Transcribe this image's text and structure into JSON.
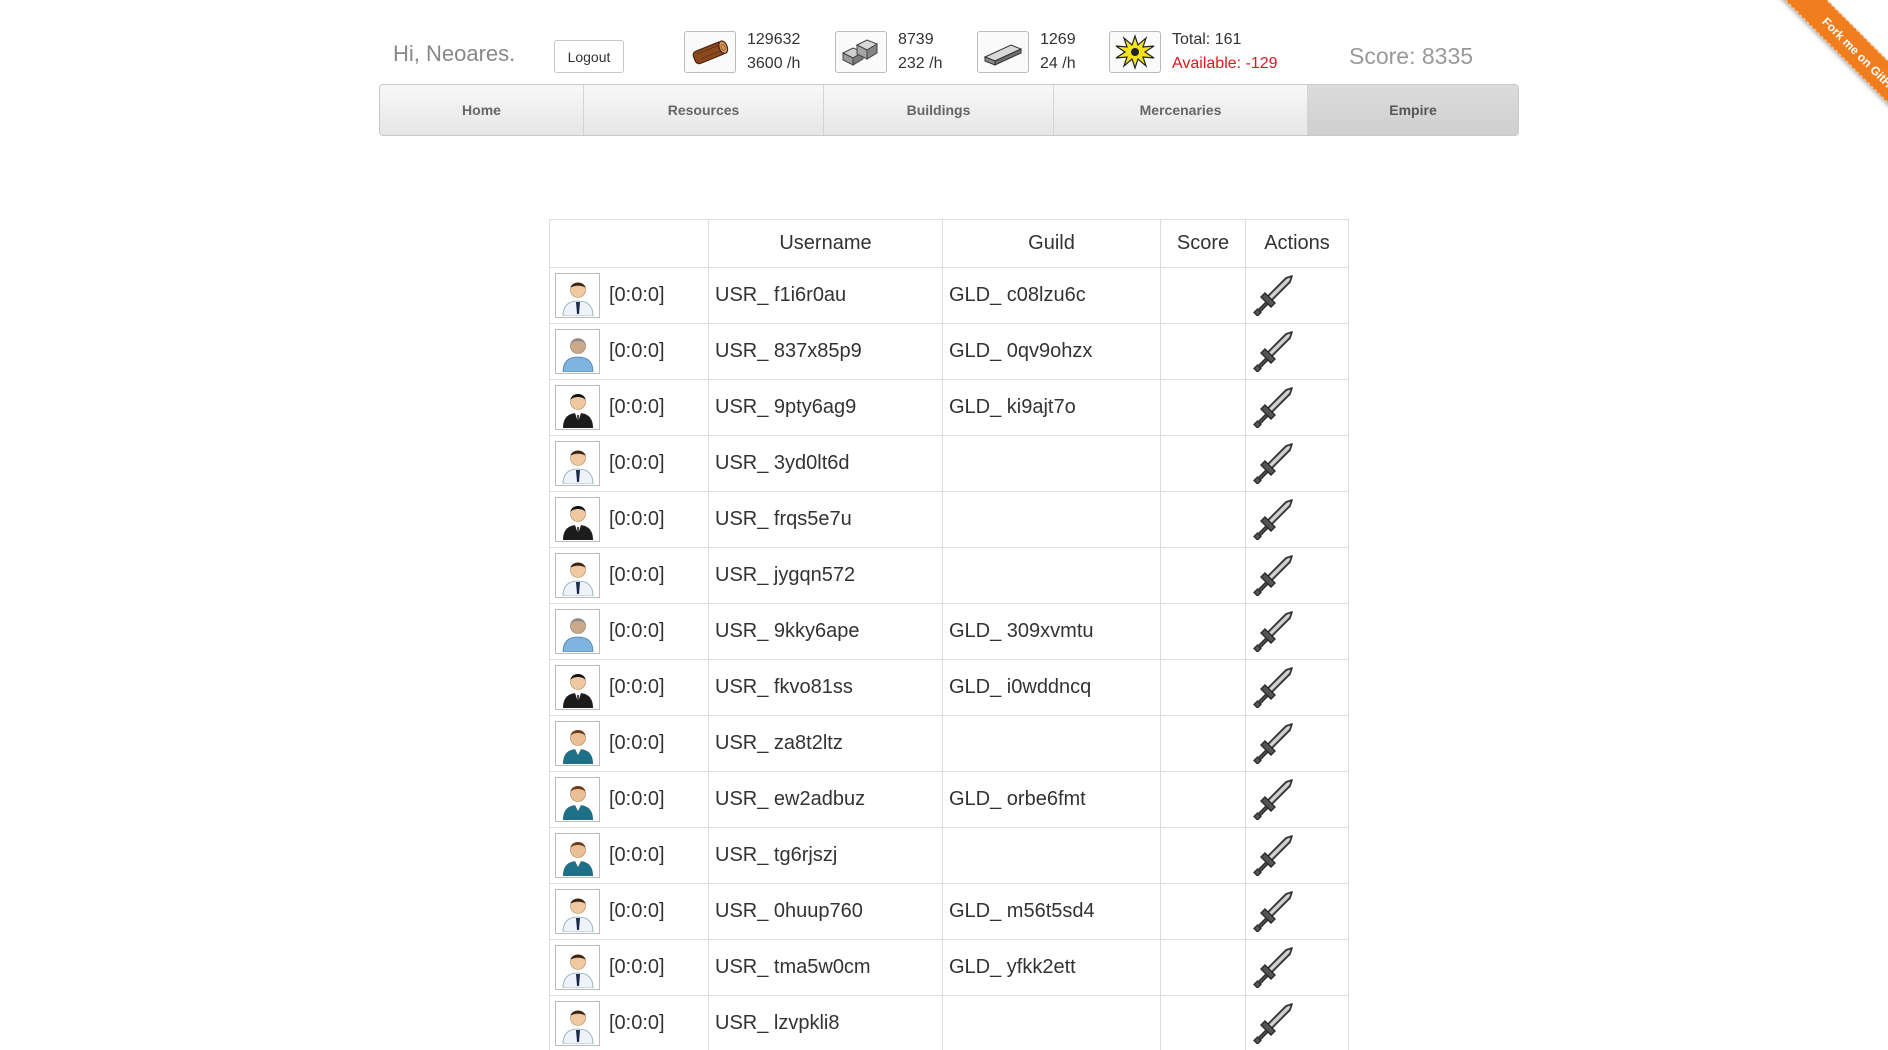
{
  "header": {
    "greeting": "Hi, Neoares.",
    "logout_label": "Logout",
    "resources": [
      {
        "icon": "wood-log-icon",
        "amount": "129632",
        "rate": "3600 /h"
      },
      {
        "icon": "stone-icon",
        "amount": "8739",
        "rate": "232 /h"
      },
      {
        "icon": "iron-ingot-icon",
        "amount": "1269",
        "rate": "24 /h"
      }
    ],
    "population": {
      "icon": "population-burst-icon",
      "total": "Total: 161",
      "available": "Available: -129"
    },
    "score": "Score: 8335"
  },
  "nav": {
    "tabs": [
      {
        "label": "Home",
        "active": false
      },
      {
        "label": "Resources",
        "active": false
      },
      {
        "label": "Buildings",
        "active": false
      },
      {
        "label": "Mercenaries",
        "active": false
      },
      {
        "label": "Empire",
        "active": true
      }
    ]
  },
  "ribbon": {
    "label": "Fork me on GitHub"
  },
  "table": {
    "headers": [
      "",
      "Username",
      "Guild",
      "Score",
      "Actions"
    ],
    "rows": [
      {
        "avatar": "white-shirt",
        "coords": "[0:0:0]",
        "username": "USR_ f1i6r0au",
        "guild": "GLD_ c08lzu6c",
        "score": "",
        "action_icon": "sword-icon"
      },
      {
        "avatar": "grey-man",
        "coords": "[0:0:0]",
        "username": "USR_ 837x85p9",
        "guild": "GLD_ 0qv9ohzx",
        "score": "",
        "action_icon": "sword-icon"
      },
      {
        "avatar": "black-suit",
        "coords": "[0:0:0]",
        "username": "USR_ 9pty6ag9",
        "guild": "GLD_ ki9ajt7o",
        "score": "",
        "action_icon": "sword-icon"
      },
      {
        "avatar": "white-shirt",
        "coords": "[0:0:0]",
        "username": "USR_ 3yd0lt6d",
        "guild": "",
        "score": "",
        "action_icon": "sword-icon"
      },
      {
        "avatar": "black-suit",
        "coords": "[0:0:0]",
        "username": "USR_ frqs5e7u",
        "guild": "",
        "score": "",
        "action_icon": "sword-icon"
      },
      {
        "avatar": "white-shirt",
        "coords": "[0:0:0]",
        "username": "USR_ jygqn572",
        "guild": "",
        "score": "",
        "action_icon": "sword-icon"
      },
      {
        "avatar": "grey-man",
        "coords": "[0:0:0]",
        "username": "USR_ 9kky6ape",
        "guild": "GLD_ 309xvmtu",
        "score": "",
        "action_icon": "sword-icon"
      },
      {
        "avatar": "black-suit",
        "coords": "[0:0:0]",
        "username": "USR_ fkvo81ss",
        "guild": "GLD_ i0wddncq",
        "score": "",
        "action_icon": "sword-icon"
      },
      {
        "avatar": "teal-suit",
        "coords": "[0:0:0]",
        "username": "USR_ za8t2ltz",
        "guild": "",
        "score": "",
        "action_icon": "sword-icon"
      },
      {
        "avatar": "teal-suit",
        "coords": "[0:0:0]",
        "username": "USR_ ew2adbuz",
        "guild": "GLD_ orbe6fmt",
        "score": "",
        "action_icon": "sword-icon"
      },
      {
        "avatar": "teal-suit",
        "coords": "[0:0:0]",
        "username": "USR_ tg6rjszj",
        "guild": "",
        "score": "",
        "action_icon": "sword-icon"
      },
      {
        "avatar": "white-shirt",
        "coords": "[0:0:0]",
        "username": "USR_ 0huup760",
        "guild": "GLD_ m56t5sd4",
        "score": "",
        "action_icon": "sword-icon"
      },
      {
        "avatar": "white-shirt",
        "coords": "[0:0:0]",
        "username": "USR_ tma5w0cm",
        "guild": "GLD_ yfkk2ett",
        "score": "",
        "action_icon": "sword-icon"
      },
      {
        "avatar": "white-shirt",
        "coords": "[0:0:0]",
        "username": "USR_ lzvpkli8",
        "guild": "",
        "score": "",
        "action_icon": "sword-icon"
      }
    ]
  },
  "colors": {
    "available_negative": "#e3161a",
    "ribbon": "#f07d1e",
    "muted_text": "#999999"
  }
}
